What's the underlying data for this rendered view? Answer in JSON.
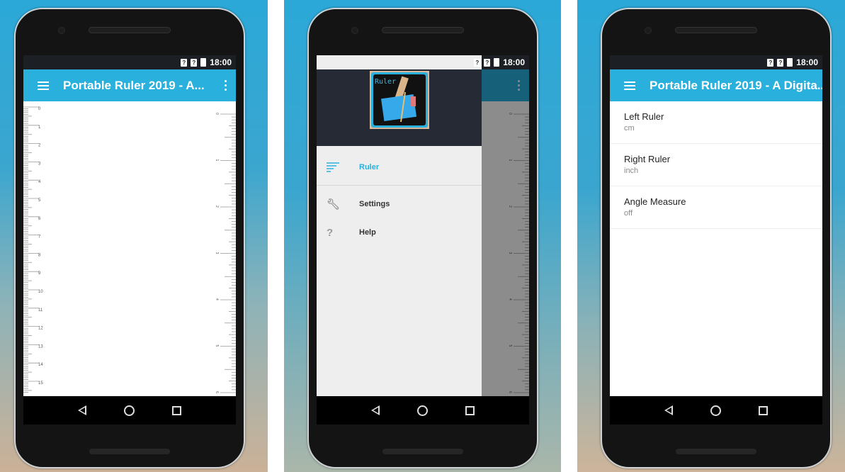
{
  "status_bar": {
    "time": "18:00",
    "sim1_icon": "?",
    "sim2_icon": "?"
  },
  "app_title_short": "Portable Ruler 2019 - A...",
  "app_title_long": "Portable Ruler 2019 - A Digita...",
  "navigation": {
    "back": "back-icon",
    "home": "home-icon",
    "recent": "recents-icon"
  },
  "ruler_screen": {
    "left_ruler": {
      "unit": "cm",
      "labels": [
        "0",
        "1",
        "2",
        "3",
        "4",
        "5",
        "6",
        "7",
        "8",
        "9",
        "10",
        "11",
        "12",
        "13",
        "14",
        "15"
      ]
    },
    "right_ruler": {
      "unit": "inch",
      "labels": [
        "0",
        "1",
        "2",
        "3",
        "4",
        "5",
        "6"
      ]
    }
  },
  "drawer": {
    "logo_text": "Ruler",
    "items": [
      {
        "label": "Ruler",
        "icon": "filter-list-icon",
        "active": true
      },
      {
        "label": "Settings",
        "icon": "wrench-icon",
        "active": false
      },
      {
        "label": "Help",
        "icon": "help-icon",
        "active": false
      }
    ]
  },
  "settings": {
    "items": [
      {
        "title": "Left Ruler",
        "summary": "cm"
      },
      {
        "title": "Right Ruler",
        "summary": "inch"
      },
      {
        "title": "Angle Measure",
        "summary": "off"
      }
    ]
  }
}
